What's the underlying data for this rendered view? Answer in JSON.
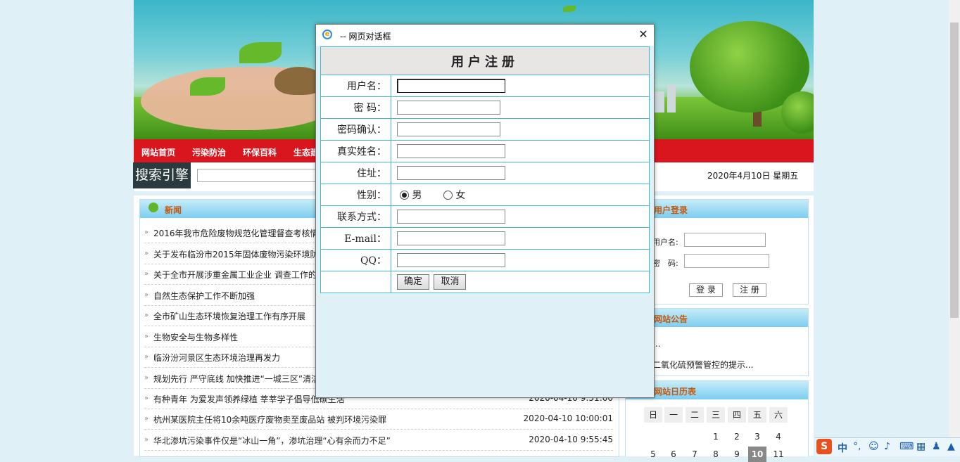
{
  "site": {
    "nav": [
      "网站首页",
      "污染防治",
      "环保百科",
      "生态建"
    ],
    "search_label": "搜索引擎",
    "date": "2020年4月10日 星期五"
  },
  "news": {
    "title": "新闻",
    "items": [
      {
        "title": "2016年我市危险废物规范化管理督查考核情",
        "date": ""
      },
      {
        "title": "关于发布临汾市2015年固体废物污染环境防",
        "date": ""
      },
      {
        "title": "关于全市开展涉重金属工业企业 调查工作的",
        "date": ""
      },
      {
        "title": "自然生态保护工作不断加强",
        "date": ""
      },
      {
        "title": "全市矿山生态环境恢复治理工作有序开展",
        "date": ""
      },
      {
        "title": "生物安全与生物多样性",
        "date": ""
      },
      {
        "title": "临汾汾河景区生态环境治理再发力",
        "date": ""
      },
      {
        "title": "规划先行 严守底线 加快推进“一城三区”清洁",
        "date": ""
      },
      {
        "title": "有种青年 为爱发声领养绿植 莘莘学子倡导低碳生活",
        "date": "2020-04-10 9:51:00"
      },
      {
        "title": "杭州某医院主任将10余吨医疗废物卖至废品站 被判环境污染罪",
        "date": "2020-04-10 10:00:01"
      },
      {
        "title": "华北渗坑污染事件仅是“冰山一角”，渗坑治理“心有余而力不足”",
        "date": "2020-04-10 9:55:45"
      }
    ]
  },
  "login": {
    "title": "用户登录",
    "user_label": "用户名:",
    "pass_label": "密　码:",
    "login_btn": "登 录",
    "register_btn": "注 册"
  },
  "notice": {
    "title": "网站公告",
    "items": [
      "...",
      "二氧化硫预警管控的提示..."
    ]
  },
  "calendar": {
    "title": "网站日历表",
    "weekdays": [
      "日",
      "一",
      "二",
      "三",
      "四",
      "五",
      "六"
    ],
    "row1": [
      "",
      "",
      "",
      "1",
      "2",
      "3",
      "4"
    ],
    "row2": [
      "5",
      "6",
      "7",
      "8",
      "9",
      "10",
      "11"
    ],
    "today": "10"
  },
  "dialog": {
    "title": "-- 网页对话框",
    "heading": "用户注册",
    "fields": {
      "username": "用户名：",
      "password": "密 码：",
      "confirm": "密码确认：",
      "realname": "真实姓名：",
      "address": "住址：",
      "gender": "性别：",
      "contact": "联系方式：",
      "email": "E-mail：",
      "qq": "QQ："
    },
    "gender_options": {
      "male": "男",
      "female": "女",
      "selected": "男"
    },
    "ok": "确定",
    "cancel": "取消"
  },
  "ime": {
    "mode": "中"
  }
}
